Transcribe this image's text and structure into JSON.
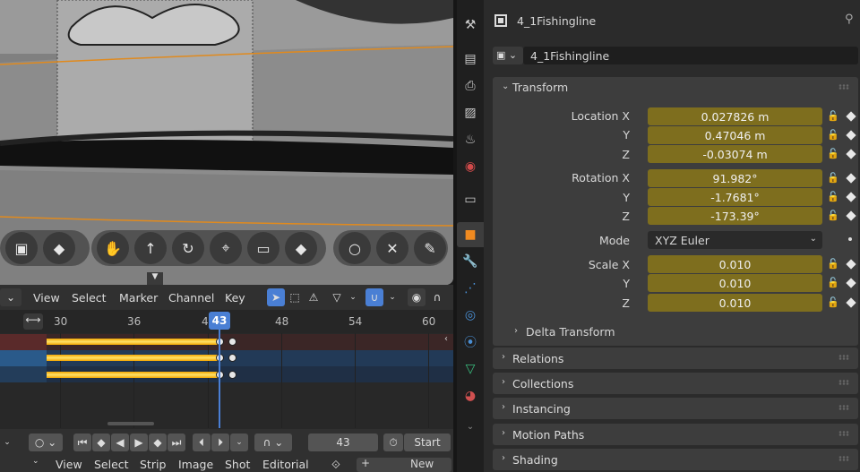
{
  "viewport": {
    "tools": [
      "display-icon",
      "keyframe-icon",
      "hand-icon",
      "arrow-up-icon",
      "rotate-icon",
      "camera-icon",
      "screen-icon",
      "keyframe2-icon",
      "circle-icon",
      "cursor-icon",
      "pencil-icon"
    ]
  },
  "timeline": {
    "menu": {
      "view": "View",
      "select": "Select",
      "marker": "Marker",
      "channel": "Channel",
      "key": "Key"
    },
    "ticks": [
      "30",
      "36",
      "4",
      "48",
      "54",
      "60"
    ],
    "current_frame": "43",
    "frame_field": "43",
    "start_label": "Start",
    "channel_colors": [
      "#5a2a2a",
      "#2a5a8a",
      "#233d5a"
    ]
  },
  "bottom_header": {
    "view": "View",
    "select": "Select",
    "strip": "Strip",
    "image": "Image",
    "shot": "Shot",
    "editorial": "Editorial",
    "new": "New"
  },
  "properties": {
    "object_name": "4_1Fishingline",
    "data_name": "4_1Fishingline",
    "transform": {
      "title": "Transform",
      "location": {
        "label_x": "Location X",
        "label_y": "Y",
        "label_z": "Z",
        "x": "0.027826 m",
        "y": "0.47046 m",
        "z": "-0.03074 m"
      },
      "rotation": {
        "label_x": "Rotation X",
        "label_y": "Y",
        "label_z": "Z",
        "x": "91.982°",
        "y": "-1.7681°",
        "z": "-173.39°"
      },
      "mode": {
        "label": "Mode",
        "value": "XYZ Euler"
      },
      "scale": {
        "label_x": "Scale X",
        "label_y": "Y",
        "label_z": "Z",
        "x": "0.010",
        "y": "0.010",
        "z": "0.010"
      },
      "delta": "Delta Transform"
    },
    "sections": [
      "Relations",
      "Collections",
      "Instancing",
      "Motion Paths",
      "Shading"
    ]
  },
  "colors": {
    "field": "#7e6e1e",
    "accent": "#4a7fd4",
    "keyframe_bar": "#f2c200"
  }
}
